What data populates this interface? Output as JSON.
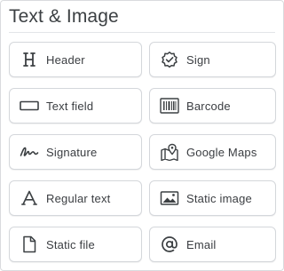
{
  "panel": {
    "title": "Text & Image"
  },
  "tiles": [
    {
      "label": "Header",
      "icon": "header-icon"
    },
    {
      "label": "Sign",
      "icon": "sign-badge-icon"
    },
    {
      "label": "Text field",
      "icon": "text-field-icon"
    },
    {
      "label": "Barcode",
      "icon": "barcode-icon"
    },
    {
      "label": "Signature",
      "icon": "signature-icon"
    },
    {
      "label": "Google Maps",
      "icon": "map-pin-icon"
    },
    {
      "label": "Regular text",
      "icon": "regular-text-icon"
    },
    {
      "label": "Static image",
      "icon": "image-icon"
    },
    {
      "label": "Static file",
      "icon": "file-icon"
    },
    {
      "label": "Email",
      "icon": "at-sign-icon"
    }
  ],
  "colors": {
    "text": "#3a3d41",
    "icon": "#3c4043",
    "border": "#d4d7db"
  }
}
